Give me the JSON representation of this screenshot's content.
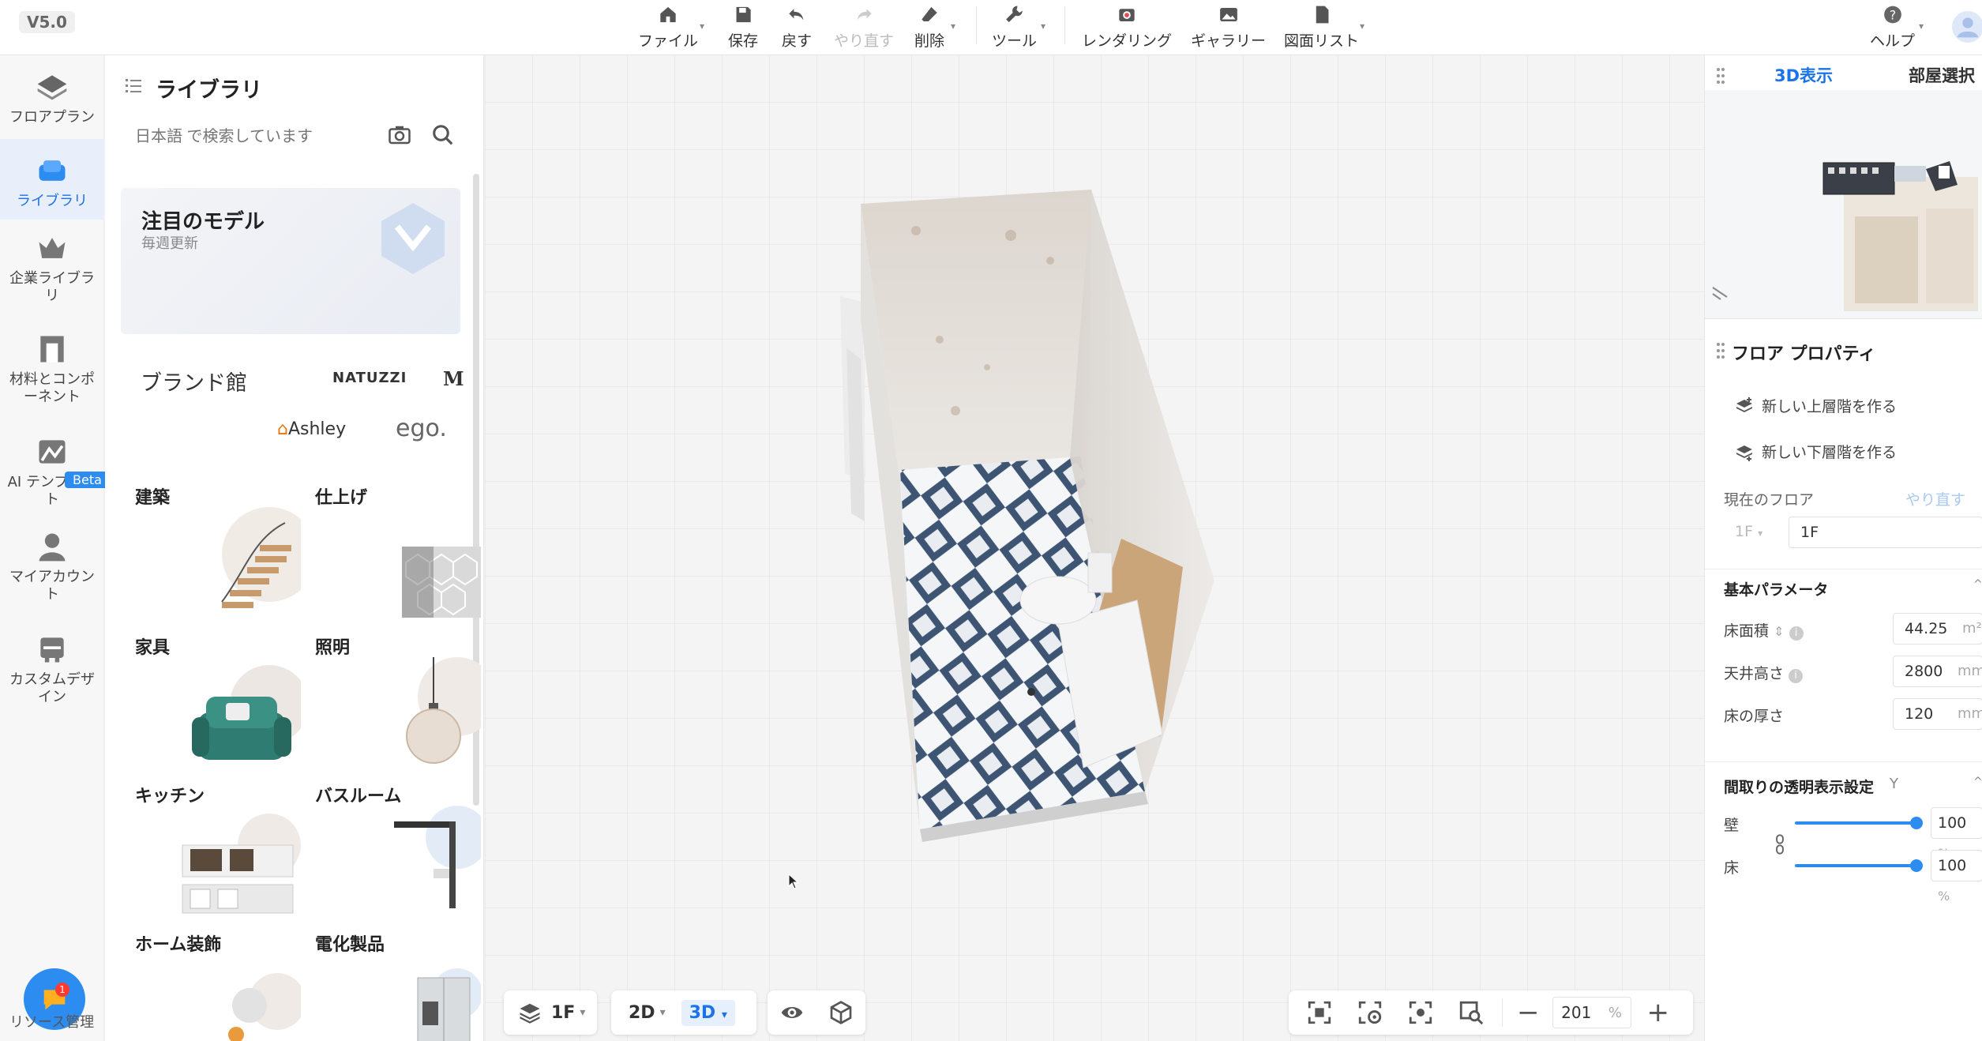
{
  "app": {
    "version": "V5.0"
  },
  "toolbar": {
    "file": "ファイル",
    "save": "保存",
    "undo": "戻す",
    "redo": "やり直す",
    "delete": "削除",
    "tools": "ツール",
    "rendering": "レンダリング",
    "gallery": "ギャラリー",
    "drawing_list": "図面リスト",
    "help": "ヘルプ"
  },
  "leftnav": {
    "items": [
      {
        "label": "フロアプラン",
        "icon": "floorplan-icon"
      },
      {
        "label": "ライブラリ",
        "icon": "library-icon",
        "active": true
      },
      {
        "label": "企業ライブラリ",
        "icon": "enterprise-library-icon"
      },
      {
        "label": "材料とコンポーネント",
        "icon": "materials-icon"
      },
      {
        "label": "AI テンプレート",
        "icon": "ai-template-icon",
        "badge": "Beta"
      },
      {
        "label": "マイアカウント",
        "icon": "account-icon"
      },
      {
        "label": "カスタムデザイン",
        "icon": "custom-design-icon"
      }
    ],
    "bottom_label": "リソース管理"
  },
  "library": {
    "title": "ライブラリ",
    "search_placeholder": "日本語 で検索しています",
    "featured": {
      "title": "注目のモデル",
      "subtitle": "毎週更新"
    },
    "brands_title": "ブランド館",
    "brands": [
      "NATUZZI",
      "M",
      "Ashley",
      "ego."
    ],
    "categories": [
      "建築",
      "仕上げ",
      "家具",
      "照明",
      "キッチン",
      "バスルーム",
      "ホーム装飾",
      "電化製品"
    ]
  },
  "viewport": {
    "floor": "1F",
    "view2d": "2D",
    "view3d": "3D",
    "zoom": "201",
    "zoom_unit": "%"
  },
  "right": {
    "tab_3d": "3D表示",
    "tab_room": "部屋選択",
    "prop_title": "フロア プロパティ",
    "new_upper": "新しい上層階を作る",
    "new_lower": "新しい下層階を作る",
    "current_floor_label": "現在のフロア",
    "redo_link": "やり直す",
    "floor_select": "1F",
    "floor_value": "1F",
    "basic_params": "基本パラメータ",
    "floor_area_label": "床面積",
    "floor_area": "44.25",
    "floor_area_unit": "m²",
    "ceiling_label": "天井高さ",
    "ceiling": "2800",
    "ceiling_unit": "mm",
    "thickness_label": "床の厚さ",
    "thickness": "120",
    "thickness_unit": "mm",
    "transparency_title": "間取りの透明表示設定",
    "transparency_y": "Y",
    "wall_label": "壁",
    "wall_value": "100",
    "floor_label": "床",
    "floor_value_pct": "100",
    "pct": "%"
  }
}
